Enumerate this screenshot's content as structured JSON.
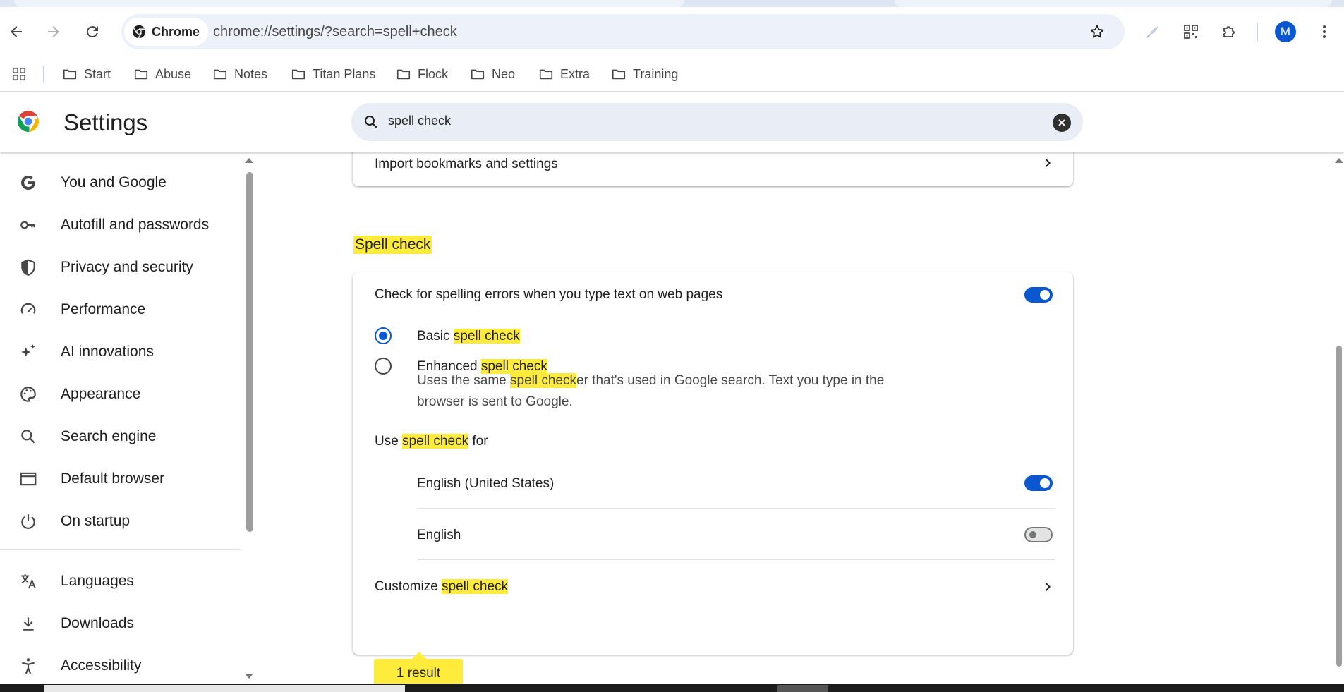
{
  "browser": {
    "chip_label": "Chrome",
    "url": "chrome://settings/?search=spell+check",
    "profile_initial": "M",
    "bookmarks": [
      "Start",
      "Abuse",
      "Notes",
      "Titan Plans",
      "Flock",
      "Neo",
      "Extra",
      "Training"
    ]
  },
  "settings": {
    "title": "Settings",
    "search_value": "spell check"
  },
  "sidebar": {
    "items": [
      {
        "label": "You and Google",
        "icon": "google-g-icon"
      },
      {
        "label": "Autofill and passwords",
        "icon": "key-icon"
      },
      {
        "label": "Privacy and security",
        "icon": "shield-icon"
      },
      {
        "label": "Performance",
        "icon": "speedometer-icon"
      },
      {
        "label": "AI innovations",
        "icon": "sparkle-icon"
      },
      {
        "label": "Appearance",
        "icon": "palette-icon"
      },
      {
        "label": "Search engine",
        "icon": "search-icon"
      },
      {
        "label": "Default browser",
        "icon": "browser-window-icon"
      },
      {
        "label": "On startup",
        "icon": "power-icon"
      },
      {
        "label": "Languages",
        "icon": "translate-icon"
      },
      {
        "label": "Downloads",
        "icon": "download-icon"
      },
      {
        "label": "Accessibility",
        "icon": "accessibility-icon"
      }
    ]
  },
  "main": {
    "import_label": "Import bookmarks and settings",
    "section_title": "Spell check",
    "check_label": "Check for spelling errors when you type text on web pages",
    "basic_prefix": "Basic ",
    "basic_hl": "spell check",
    "enhanced_prefix": "Enhanced ",
    "enhanced_hl": "spell check",
    "enhanced_desc_pre": "Uses the same ",
    "enhanced_desc_hl": "spell check",
    "enhanced_desc_post": "er that's used in Google search. Text you type in the browser is sent to Google.",
    "use_prefix": "Use ",
    "use_hl": "spell check",
    "use_suffix": " for",
    "lang1": "English (United States)",
    "lang2": "English",
    "customize_prefix": "Customize ",
    "customize_hl": "spell check",
    "result_count": "1 result"
  },
  "state": {
    "spell_check_enabled": true,
    "mode_selected": "basic",
    "lang1_enabled": true,
    "lang2_enabled": false
  },
  "colors": {
    "accent": "#0b57d0",
    "highlight": "#ffeb3b"
  }
}
